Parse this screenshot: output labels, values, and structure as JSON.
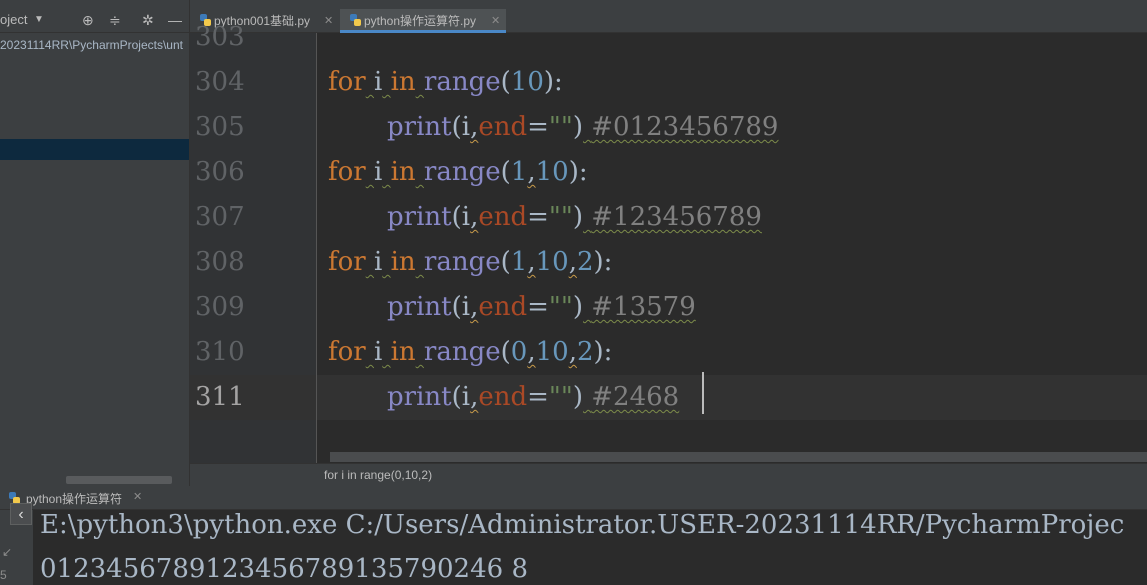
{
  "project_panel": {
    "title": "oject",
    "path": "20231114RR\\PycharmProjects\\unt"
  },
  "tabs": [
    {
      "label": "python001基础.py",
      "active": false
    },
    {
      "label": "python操作运算符.py",
      "active": true
    }
  ],
  "editor": {
    "partial_line_number": "303",
    "line_numbers": [
      "304",
      "305",
      "306",
      "307",
      "308",
      "309",
      "310",
      "311"
    ],
    "current_line": "311",
    "lines": [
      {
        "kw": "for",
        "var": "i",
        "in": "in",
        "fn": "range",
        "args": [
          "10"
        ]
      },
      {
        "call": "print",
        "var": "i",
        "kwarg": "end",
        "str": "\"\"",
        "comment": "#0123456789"
      },
      {
        "kw": "for",
        "var": "i",
        "in": "in",
        "fn": "range",
        "args": [
          "1",
          "10"
        ]
      },
      {
        "call": "print",
        "var": "i",
        "kwarg": "end",
        "str": "\"\"",
        "comment": "#123456789"
      },
      {
        "kw": "for",
        "var": "i",
        "in": "in",
        "fn": "range",
        "args": [
          "1",
          "10",
          "2"
        ]
      },
      {
        "call": "print",
        "var": "i",
        "kwarg": "end",
        "str": "\"\"",
        "comment": "#13579"
      },
      {
        "kw": "for",
        "var": "i",
        "in": "in",
        "fn": "range",
        "args": [
          "0",
          "10",
          "2"
        ]
      },
      {
        "call": "print",
        "var": "i",
        "kwarg": "end",
        "str": "\"\"",
        "comment": "#2468"
      }
    ]
  },
  "breadcrumb": "for i in range(0,10,2)",
  "run_panel": {
    "tab_label": "python操作运算符",
    "side_mark": "↙",
    "side_num": "5",
    "console_lines": [
      "E:\\python3\\python.exe C:/Users/Administrator.USER-20231114RR/PycharmProjec",
      "0123456789123456789135790246 8"
    ]
  },
  "icons": {
    "locate": "crosshair-icon",
    "collapse": "collapse-icon",
    "settings": "gear-icon",
    "hide": "minimize-icon"
  },
  "colors": {
    "keyword": "#cc7832",
    "builtin": "#8888c6",
    "number": "#6897bb",
    "string": "#6a8759",
    "kwarg": "#aa4926",
    "comment": "#808080",
    "tab_underline": "#4a88c7"
  }
}
